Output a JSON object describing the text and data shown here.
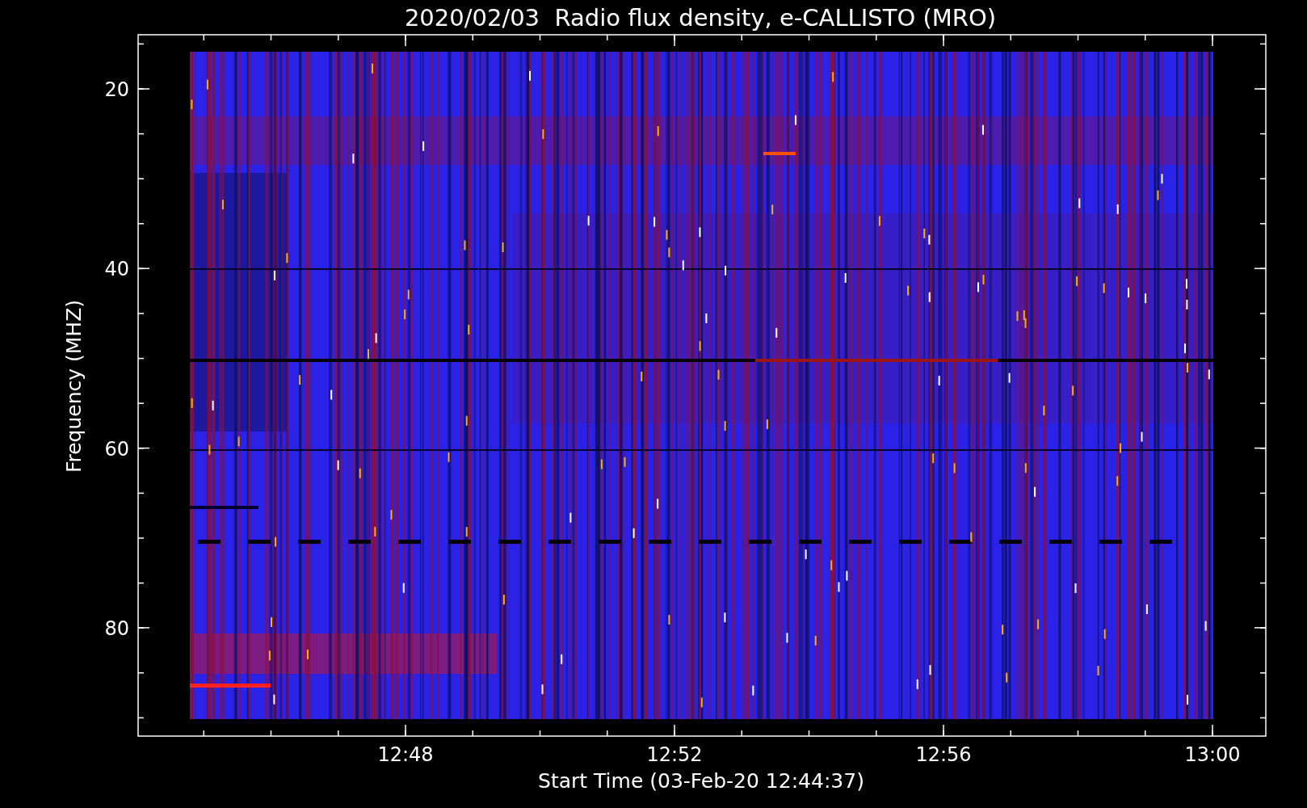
{
  "title": "2020/02/03  Radio flux density, e-CALLISTO (MRO)",
  "ylabel": "Frequency (MHZ)",
  "xlabel": "Start Time (03-Feb-20 12:44:37)",
  "yticks": [
    "20",
    "40",
    "60",
    "80"
  ],
  "xticks": [
    "12:48",
    "12:52",
    "12:56",
    "13:00"
  ]
}
